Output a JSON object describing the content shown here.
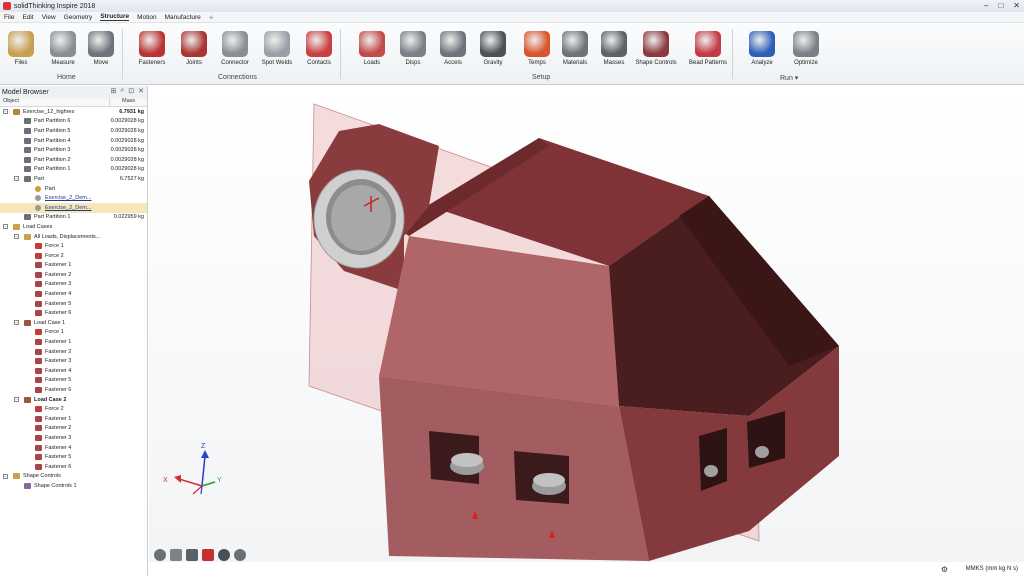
{
  "app": {
    "title": "solidThinking Inspire 2018"
  },
  "window": {
    "minimize": "–",
    "maximize": "□",
    "close": "✕"
  },
  "menu": {
    "items": [
      "File",
      "Edit",
      "View",
      "Geometry",
      "Structure",
      "Motion",
      "Manufacture"
    ],
    "active": "Structure",
    "add": "+"
  },
  "ribbon": {
    "buttons": [
      {
        "label": "Files",
        "icon": "files-icon"
      },
      {
        "label": "Measure",
        "icon": "measure-icon"
      },
      {
        "label": "Move",
        "icon": "move-icon"
      },
      {
        "label": "Fasteners",
        "icon": "fasteners-icon"
      },
      {
        "label": "Joints",
        "icon": "joints-icon"
      },
      {
        "label": "Connector",
        "icon": "connector-icon"
      },
      {
        "label": "Spot Welds",
        "icon": "spot-welds-icon"
      },
      {
        "label": "Contacts",
        "icon": "contacts-icon"
      },
      {
        "label": "Loads",
        "icon": "loads-icon"
      },
      {
        "label": "Disps",
        "icon": "disps-icon"
      },
      {
        "label": "Accels",
        "icon": "accels-icon"
      },
      {
        "label": "Gravity",
        "icon": "gravity-icon"
      },
      {
        "label": "Temps",
        "icon": "temps-icon"
      },
      {
        "label": "Materials",
        "icon": "materials-icon"
      },
      {
        "label": "Masses",
        "icon": "masses-icon"
      },
      {
        "label": "Shape Controls",
        "icon": "shape-controls-icon"
      },
      {
        "label": "Bead Patterns",
        "icon": "bead-patterns-icon"
      },
      {
        "label": "Analyze",
        "icon": "analyze-icon"
      },
      {
        "label": "Optimize",
        "icon": "optimize-icon"
      }
    ],
    "groups": {
      "home": "Home",
      "connections": "Connections",
      "setup": "Setup",
      "run": "Run ▾"
    }
  },
  "browser": {
    "title": "Model Browser",
    "col_object": "Object",
    "col_mass": "Mass",
    "rows": [
      {
        "level": 0,
        "exp": "−",
        "icon": "assembly-icon",
        "text": "Exercise_12_highres",
        "mass": "6.7931 kg",
        "massBold": true
      },
      {
        "level": 1,
        "icon": "part-icon",
        "text": "Part Partition 6",
        "mass": "0.0029028 kg"
      },
      {
        "level": 1,
        "icon": "part-icon",
        "text": "Part Partition 5",
        "mass": "0.0029028 kg"
      },
      {
        "level": 1,
        "icon": "part-icon",
        "text": "Part Partition 4",
        "mass": "0.0029028 kg"
      },
      {
        "level": 1,
        "icon": "part-icon",
        "text": "Part Partition 3",
        "mass": "0.0029028 kg"
      },
      {
        "level": 1,
        "icon": "part-icon",
        "text": "Part Partition 2",
        "mass": "0.0029028 kg"
      },
      {
        "level": 1,
        "icon": "part-icon",
        "text": "Part Partition 1",
        "mass": "0.0029028 kg"
      },
      {
        "level": 1,
        "exp": "−",
        "icon": "part-icon",
        "text": "Part",
        "mass": "6.7527 kg"
      },
      {
        "level": 2,
        "icon": "radio-on-icon",
        "text": "Part"
      },
      {
        "level": 2,
        "icon": "radio-off-icon",
        "text": "Exercise_2_Dem...",
        "link": true
      },
      {
        "level": 2,
        "icon": "radio-off-icon",
        "text": "Exercise_2_Dem...",
        "link": true,
        "sel": true
      },
      {
        "level": 1,
        "icon": "part-icon",
        "text": "Part Partition 1",
        "mass": "0.022959 kg"
      },
      {
        "level": 0,
        "exp": "−",
        "icon": "folder-icon",
        "text": "Load Cases"
      },
      {
        "level": 1,
        "exp": "−",
        "icon": "folder-icon",
        "text": "All Loads, Displacements..."
      },
      {
        "level": 2,
        "icon": "force-icon",
        "text": "Force 1"
      },
      {
        "level": 2,
        "icon": "force-icon",
        "text": "Force 2"
      },
      {
        "level": 2,
        "icon": "fastener-icon",
        "text": "Fastener 1"
      },
      {
        "level": 2,
        "icon": "fastener-icon",
        "text": "Fastener 2"
      },
      {
        "level": 2,
        "icon": "fastener-icon",
        "text": "Fastener 3"
      },
      {
        "level": 2,
        "icon": "fastener-icon",
        "text": "Fastener 4"
      },
      {
        "level": 2,
        "icon": "fastener-icon",
        "text": "Fastener 5"
      },
      {
        "level": 2,
        "icon": "fastener-icon",
        "text": "Fastener 6"
      },
      {
        "level": 1,
        "exp": "−",
        "icon": "loadcase-icon",
        "text": "Load Case 1"
      },
      {
        "level": 2,
        "icon": "force-icon",
        "text": "Force 1"
      },
      {
        "level": 2,
        "icon": "fastener-icon",
        "text": "Fastener 1"
      },
      {
        "level": 2,
        "icon": "fastener-icon",
        "text": "Fastener 2"
      },
      {
        "level": 2,
        "icon": "fastener-icon",
        "text": "Fastener 3"
      },
      {
        "level": 2,
        "icon": "fastener-icon",
        "text": "Fastener 4"
      },
      {
        "level": 2,
        "icon": "fastener-icon",
        "text": "Fastener 5"
      },
      {
        "level": 2,
        "icon": "fastener-icon",
        "text": "Fastener 6"
      },
      {
        "level": 1,
        "exp": "−",
        "icon": "loadcase-icon",
        "text": "Load Case 2",
        "bold": true
      },
      {
        "level": 2,
        "icon": "force-icon",
        "text": "Force 2"
      },
      {
        "level": 2,
        "icon": "fastener-icon",
        "text": "Fastener 1"
      },
      {
        "level": 2,
        "icon": "fastener-icon",
        "text": "Fastener 2"
      },
      {
        "level": 2,
        "icon": "fastener-icon",
        "text": "Fastener 3"
      },
      {
        "level": 2,
        "icon": "fastener-icon",
        "text": "Fastener 4"
      },
      {
        "level": 2,
        "icon": "fastener-icon",
        "text": "Fastener 5"
      },
      {
        "level": 2,
        "icon": "fastener-icon",
        "text": "Fastener 6"
      },
      {
        "level": 0,
        "exp": "−",
        "icon": "folder-icon",
        "text": "Shape Controls"
      },
      {
        "level": 1,
        "icon": "shape-control-icon",
        "text": "Shape Controls 1"
      }
    ]
  },
  "viewport": {
    "triad": {
      "x": "X",
      "y": "Y",
      "z": "Z"
    },
    "colors": {
      "part": "#7a2e30",
      "part_light": "#b0686a",
      "plane": "#e8b4b6",
      "triad_z": "#2a3fc8",
      "triad_x": "#d23030",
      "triad_y": "#2e9a3a"
    }
  },
  "status": {
    "units": "MMKS (mm kg N s)"
  },
  "bottom_tools": [
    "view-cube-icon",
    "section-icon",
    "shaded-icon",
    "render-icon",
    "zoom-icon",
    "rotate-icon"
  ]
}
